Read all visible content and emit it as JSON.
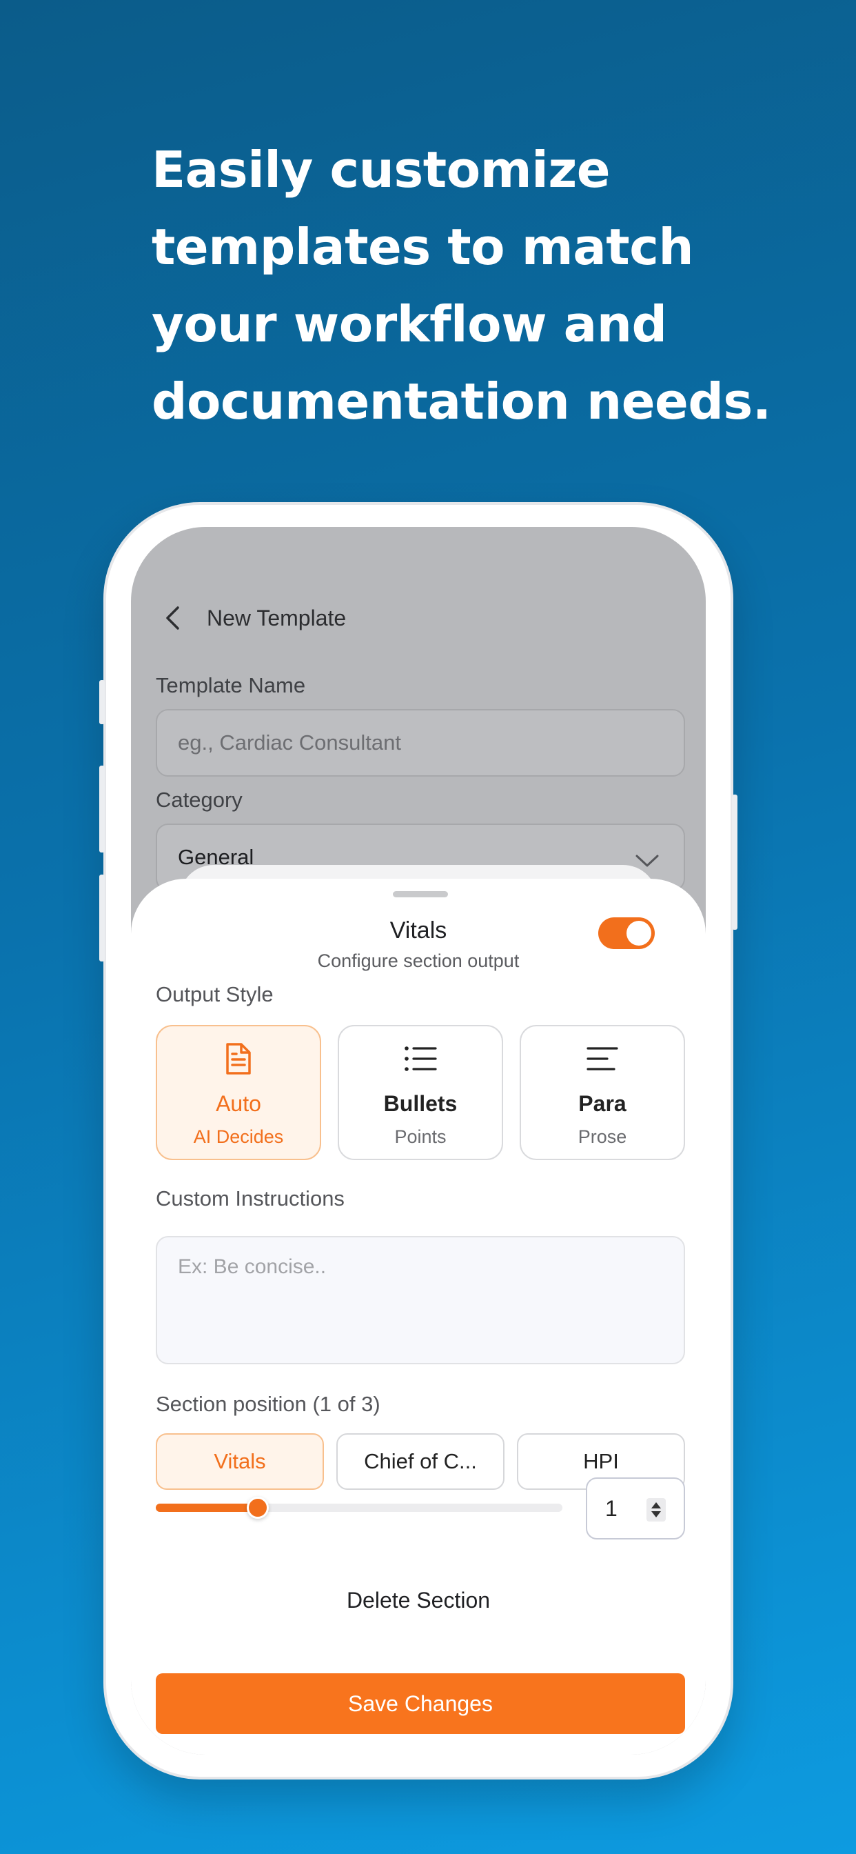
{
  "headline": {
    "line1": "Easily customize",
    "line2": "templates to match",
    "line3": "your workflow and",
    "line4": "documentation needs."
  },
  "colors": {
    "accent": "#f26f1c",
    "background_top": "#0b5c8a",
    "background_bottom": "#0d9be0"
  },
  "screen": {
    "title": "New Template",
    "back_icon": "chevron-left-icon",
    "template_name": {
      "label": "Template Name",
      "placeholder": "eg., Cardiac Consultant"
    },
    "category": {
      "label": "Category",
      "value": "General"
    }
  },
  "sheet": {
    "title": "Vitals",
    "subtitle": "Configure section output",
    "toggle_on": true,
    "output_style": {
      "label": "Output Style",
      "options": [
        {
          "title": "Auto",
          "subtitle": "AI Decides",
          "icon": "document-icon",
          "selected": true
        },
        {
          "title": "Bullets",
          "subtitle": "Points",
          "icon": "list-icon",
          "selected": false
        },
        {
          "title": "Para",
          "subtitle": "Prose",
          "icon": "paragraph-icon",
          "selected": false
        }
      ]
    },
    "custom_instructions": {
      "label": "Custom Instructions",
      "placeholder": "Ex: Be concise.."
    },
    "section_position": {
      "label": "Section position (1 of 3)",
      "sections": [
        "Vitals",
        "Chief of C...",
        "HPI"
      ],
      "selected_index": 0,
      "slider_fraction": 0.25,
      "value": "1"
    },
    "delete_label": "Delete Section",
    "save_label": "Save Changes"
  }
}
